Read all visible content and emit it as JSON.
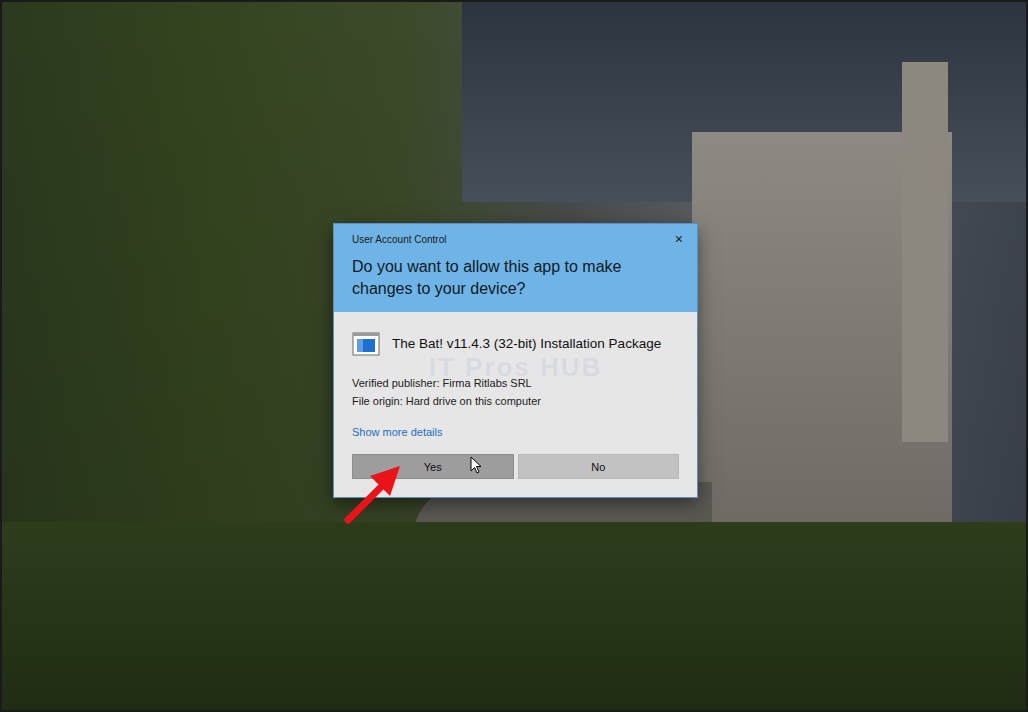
{
  "window": {
    "title": "User Account Control"
  },
  "close": "×",
  "question": "Do you want to allow this app to make changes to your device?",
  "app": {
    "name": "The Bat! v11.4.3 (32-bit) Installation Package"
  },
  "details": [
    "Verified publisher: Firma Ritlabs SRL",
    "File origin: Hard drive on this computer"
  ],
  "link": "Show more details",
  "buttons": [
    {
      "label": "Yes",
      "hovered": true
    },
    {
      "label": "No",
      "hovered": false
    }
  ],
  "watermark": "IT Pros HUB"
}
